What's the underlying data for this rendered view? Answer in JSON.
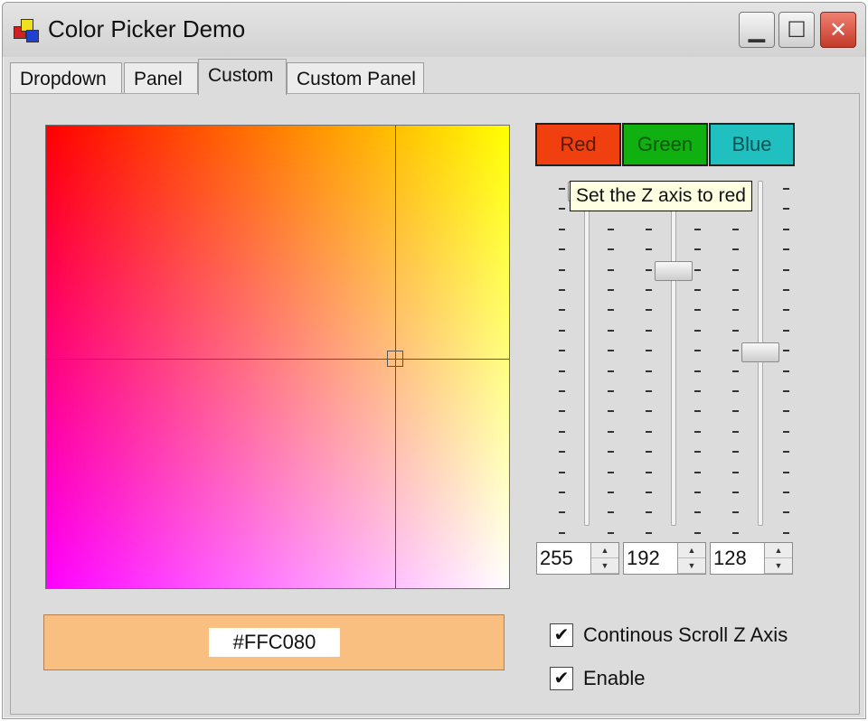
{
  "window": {
    "title": "Color Picker Demo",
    "controls": {
      "minimize": "▁",
      "maximize": "☐",
      "close": "✕"
    }
  },
  "tabs": [
    {
      "label": "Dropdown"
    },
    {
      "label": "Panel"
    },
    {
      "label": "Custom",
      "active": true
    },
    {
      "label": "Custom Panel"
    }
  ],
  "picker": {
    "hex_value": "#FFC080",
    "selected_color": "#ffc080",
    "swatch_color": "#f8bf80"
  },
  "channel_buttons": [
    {
      "label": "Red",
      "color": "#f04010",
      "text_color": "#5a1a00"
    },
    {
      "label": "Green",
      "color": "#10b010",
      "text_color": "#0a5a0a"
    },
    {
      "label": "Blue",
      "color": "#20c0c0",
      "text_color": "#0a5555"
    }
  ],
  "tooltip": {
    "text": "Set the Z axis to red"
  },
  "sliders": [
    {
      "channel": "Red",
      "value": 255
    },
    {
      "channel": "Green",
      "value": 192
    },
    {
      "channel": "Blue",
      "value": 128
    }
  ],
  "spinners": [
    {
      "value": "255"
    },
    {
      "value": "192"
    },
    {
      "value": "128"
    }
  ],
  "checkboxes": [
    {
      "label": "Continous Scroll Z Axis",
      "checked": true,
      "mark": "✔"
    },
    {
      "label": "Enable",
      "checked": true,
      "mark": "✔"
    }
  ]
}
